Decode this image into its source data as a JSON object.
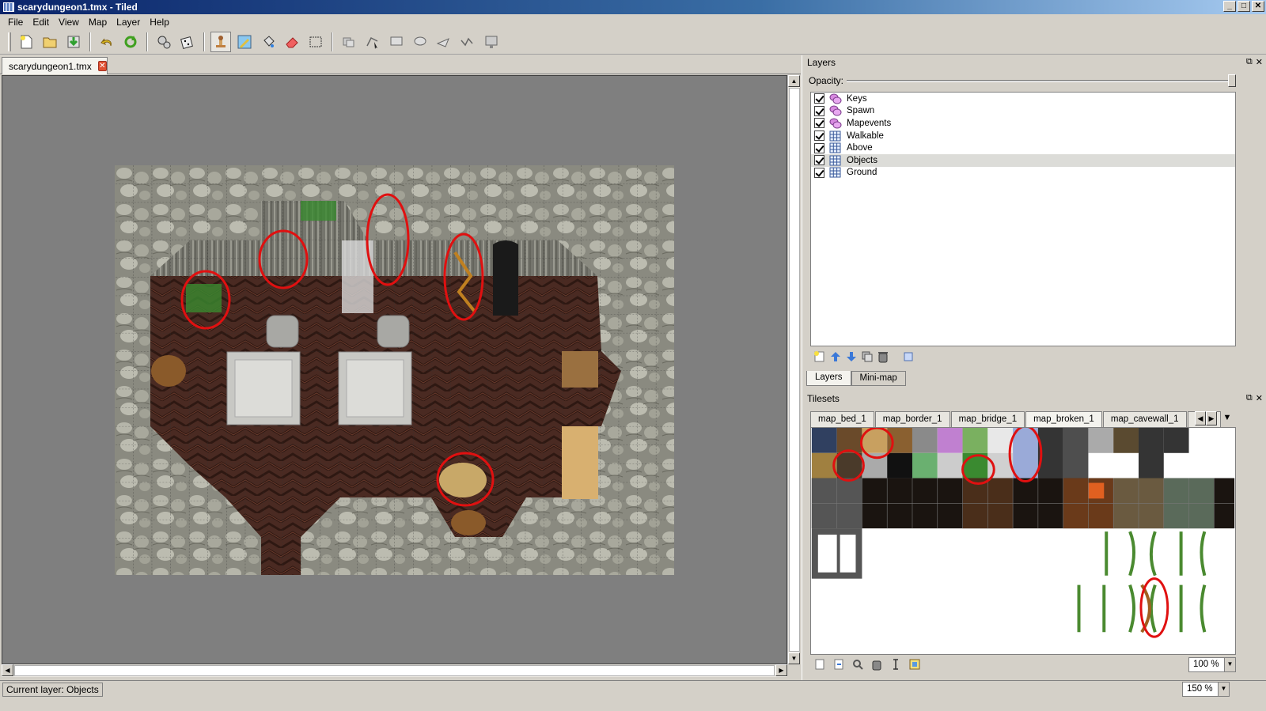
{
  "window": {
    "title": "scarydungeon1.tmx - Tiled"
  },
  "menu": [
    "File",
    "Edit",
    "View",
    "Map",
    "Layer",
    "Help"
  ],
  "toolbar": {
    "groups": [
      [
        "new-file-icon",
        "open-file-icon",
        "save-file-icon"
      ],
      [
        "undo-icon",
        "redo-icon"
      ],
      [
        "random-mode-icon",
        "dice-icon"
      ],
      [
        "stamp-brush-icon",
        "terrain-brush-icon",
        "bucket-fill-icon",
        "eraser-icon",
        "rectangle-select-icon"
      ],
      [
        "select-objects-icon",
        "edit-polygons-icon",
        "insert-rectangle-icon",
        "insert-ellipse-icon",
        "insert-polygon-icon",
        "insert-polyline-icon",
        "insert-tile-icon"
      ]
    ]
  },
  "document_tab": {
    "label": "scarydungeon1.tmx"
  },
  "layers_panel": {
    "title": "Layers",
    "opacity_label": "Opacity:",
    "opacity_value": 1.0,
    "layers": [
      {
        "name": "Keys",
        "type": "object",
        "visible": true,
        "selected": false
      },
      {
        "name": "Spawn",
        "type": "object",
        "visible": true,
        "selected": false
      },
      {
        "name": "Mapevents",
        "type": "object",
        "visible": true,
        "selected": false
      },
      {
        "name": "Walkable",
        "type": "tile",
        "visible": true,
        "selected": false
      },
      {
        "name": "Above",
        "type": "tile",
        "visible": true,
        "selected": false
      },
      {
        "name": "Objects",
        "type": "tile",
        "visible": true,
        "selected": true
      },
      {
        "name": "Ground",
        "type": "tile",
        "visible": true,
        "selected": false
      }
    ],
    "tabs": [
      "Layers",
      "Mini-map"
    ]
  },
  "tilesets_panel": {
    "title": "Tilesets",
    "tabs": [
      "map_bed_1",
      "map_border_1",
      "map_bridge_1",
      "map_broken_1",
      "map_cavewall_1",
      "map"
    ],
    "active_tab": "map_broken_1",
    "zoom": "100 %"
  },
  "status": {
    "current_layer": "Current layer: Objects",
    "zoom": "150 %"
  }
}
